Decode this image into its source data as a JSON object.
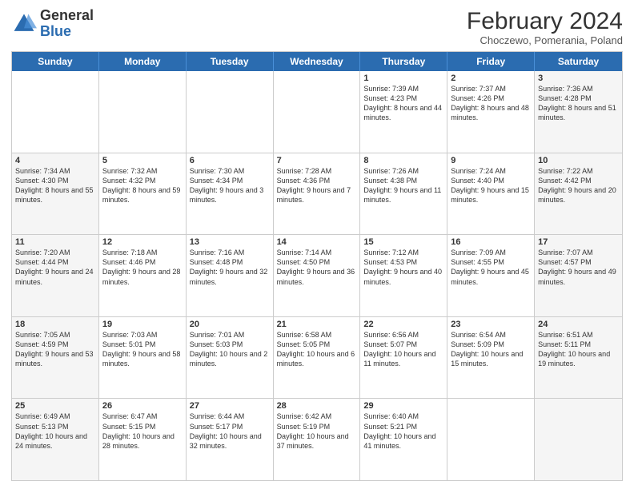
{
  "header": {
    "logo_general": "General",
    "logo_blue": "Blue",
    "title": "February 2024",
    "subtitle": "Choczewo, Pomerania, Poland"
  },
  "weekdays": [
    "Sunday",
    "Monday",
    "Tuesday",
    "Wednesday",
    "Thursday",
    "Friday",
    "Saturday"
  ],
  "rows": [
    [
      {
        "day": "",
        "text": "",
        "shaded": false
      },
      {
        "day": "",
        "text": "",
        "shaded": false
      },
      {
        "day": "",
        "text": "",
        "shaded": false
      },
      {
        "day": "",
        "text": "",
        "shaded": false
      },
      {
        "day": "1",
        "text": "Sunrise: 7:39 AM\nSunset: 4:23 PM\nDaylight: 8 hours\nand 44 minutes.",
        "shaded": false
      },
      {
        "day": "2",
        "text": "Sunrise: 7:37 AM\nSunset: 4:26 PM\nDaylight: 8 hours\nand 48 minutes.",
        "shaded": false
      },
      {
        "day": "3",
        "text": "Sunrise: 7:36 AM\nSunset: 4:28 PM\nDaylight: 8 hours\nand 51 minutes.",
        "shaded": true
      }
    ],
    [
      {
        "day": "4",
        "text": "Sunrise: 7:34 AM\nSunset: 4:30 PM\nDaylight: 8 hours\nand 55 minutes.",
        "shaded": true
      },
      {
        "day": "5",
        "text": "Sunrise: 7:32 AM\nSunset: 4:32 PM\nDaylight: 8 hours\nand 59 minutes.",
        "shaded": false
      },
      {
        "day": "6",
        "text": "Sunrise: 7:30 AM\nSunset: 4:34 PM\nDaylight: 9 hours\nand 3 minutes.",
        "shaded": false
      },
      {
        "day": "7",
        "text": "Sunrise: 7:28 AM\nSunset: 4:36 PM\nDaylight: 9 hours\nand 7 minutes.",
        "shaded": false
      },
      {
        "day": "8",
        "text": "Sunrise: 7:26 AM\nSunset: 4:38 PM\nDaylight: 9 hours\nand 11 minutes.",
        "shaded": false
      },
      {
        "day": "9",
        "text": "Sunrise: 7:24 AM\nSunset: 4:40 PM\nDaylight: 9 hours\nand 15 minutes.",
        "shaded": false
      },
      {
        "day": "10",
        "text": "Sunrise: 7:22 AM\nSunset: 4:42 PM\nDaylight: 9 hours\nand 20 minutes.",
        "shaded": true
      }
    ],
    [
      {
        "day": "11",
        "text": "Sunrise: 7:20 AM\nSunset: 4:44 PM\nDaylight: 9 hours\nand 24 minutes.",
        "shaded": true
      },
      {
        "day": "12",
        "text": "Sunrise: 7:18 AM\nSunset: 4:46 PM\nDaylight: 9 hours\nand 28 minutes.",
        "shaded": false
      },
      {
        "day": "13",
        "text": "Sunrise: 7:16 AM\nSunset: 4:48 PM\nDaylight: 9 hours\nand 32 minutes.",
        "shaded": false
      },
      {
        "day": "14",
        "text": "Sunrise: 7:14 AM\nSunset: 4:50 PM\nDaylight: 9 hours\nand 36 minutes.",
        "shaded": false
      },
      {
        "day": "15",
        "text": "Sunrise: 7:12 AM\nSunset: 4:53 PM\nDaylight: 9 hours\nand 40 minutes.",
        "shaded": false
      },
      {
        "day": "16",
        "text": "Sunrise: 7:09 AM\nSunset: 4:55 PM\nDaylight: 9 hours\nand 45 minutes.",
        "shaded": false
      },
      {
        "day": "17",
        "text": "Sunrise: 7:07 AM\nSunset: 4:57 PM\nDaylight: 9 hours\nand 49 minutes.",
        "shaded": true
      }
    ],
    [
      {
        "day": "18",
        "text": "Sunrise: 7:05 AM\nSunset: 4:59 PM\nDaylight: 9 hours\nand 53 minutes.",
        "shaded": true
      },
      {
        "day": "19",
        "text": "Sunrise: 7:03 AM\nSunset: 5:01 PM\nDaylight: 9 hours\nand 58 minutes.",
        "shaded": false
      },
      {
        "day": "20",
        "text": "Sunrise: 7:01 AM\nSunset: 5:03 PM\nDaylight: 10 hours\nand 2 minutes.",
        "shaded": false
      },
      {
        "day": "21",
        "text": "Sunrise: 6:58 AM\nSunset: 5:05 PM\nDaylight: 10 hours\nand 6 minutes.",
        "shaded": false
      },
      {
        "day": "22",
        "text": "Sunrise: 6:56 AM\nSunset: 5:07 PM\nDaylight: 10 hours\nand 11 minutes.",
        "shaded": false
      },
      {
        "day": "23",
        "text": "Sunrise: 6:54 AM\nSunset: 5:09 PM\nDaylight: 10 hours\nand 15 minutes.",
        "shaded": false
      },
      {
        "day": "24",
        "text": "Sunrise: 6:51 AM\nSunset: 5:11 PM\nDaylight: 10 hours\nand 19 minutes.",
        "shaded": true
      }
    ],
    [
      {
        "day": "25",
        "text": "Sunrise: 6:49 AM\nSunset: 5:13 PM\nDaylight: 10 hours\nand 24 minutes.",
        "shaded": true
      },
      {
        "day": "26",
        "text": "Sunrise: 6:47 AM\nSunset: 5:15 PM\nDaylight: 10 hours\nand 28 minutes.",
        "shaded": false
      },
      {
        "day": "27",
        "text": "Sunrise: 6:44 AM\nSunset: 5:17 PM\nDaylight: 10 hours\nand 32 minutes.",
        "shaded": false
      },
      {
        "day": "28",
        "text": "Sunrise: 6:42 AM\nSunset: 5:19 PM\nDaylight: 10 hours\nand 37 minutes.",
        "shaded": false
      },
      {
        "day": "29",
        "text": "Sunrise: 6:40 AM\nSunset: 5:21 PM\nDaylight: 10 hours\nand 41 minutes.",
        "shaded": false
      },
      {
        "day": "",
        "text": "",
        "shaded": false
      },
      {
        "day": "",
        "text": "",
        "shaded": true
      }
    ]
  ]
}
